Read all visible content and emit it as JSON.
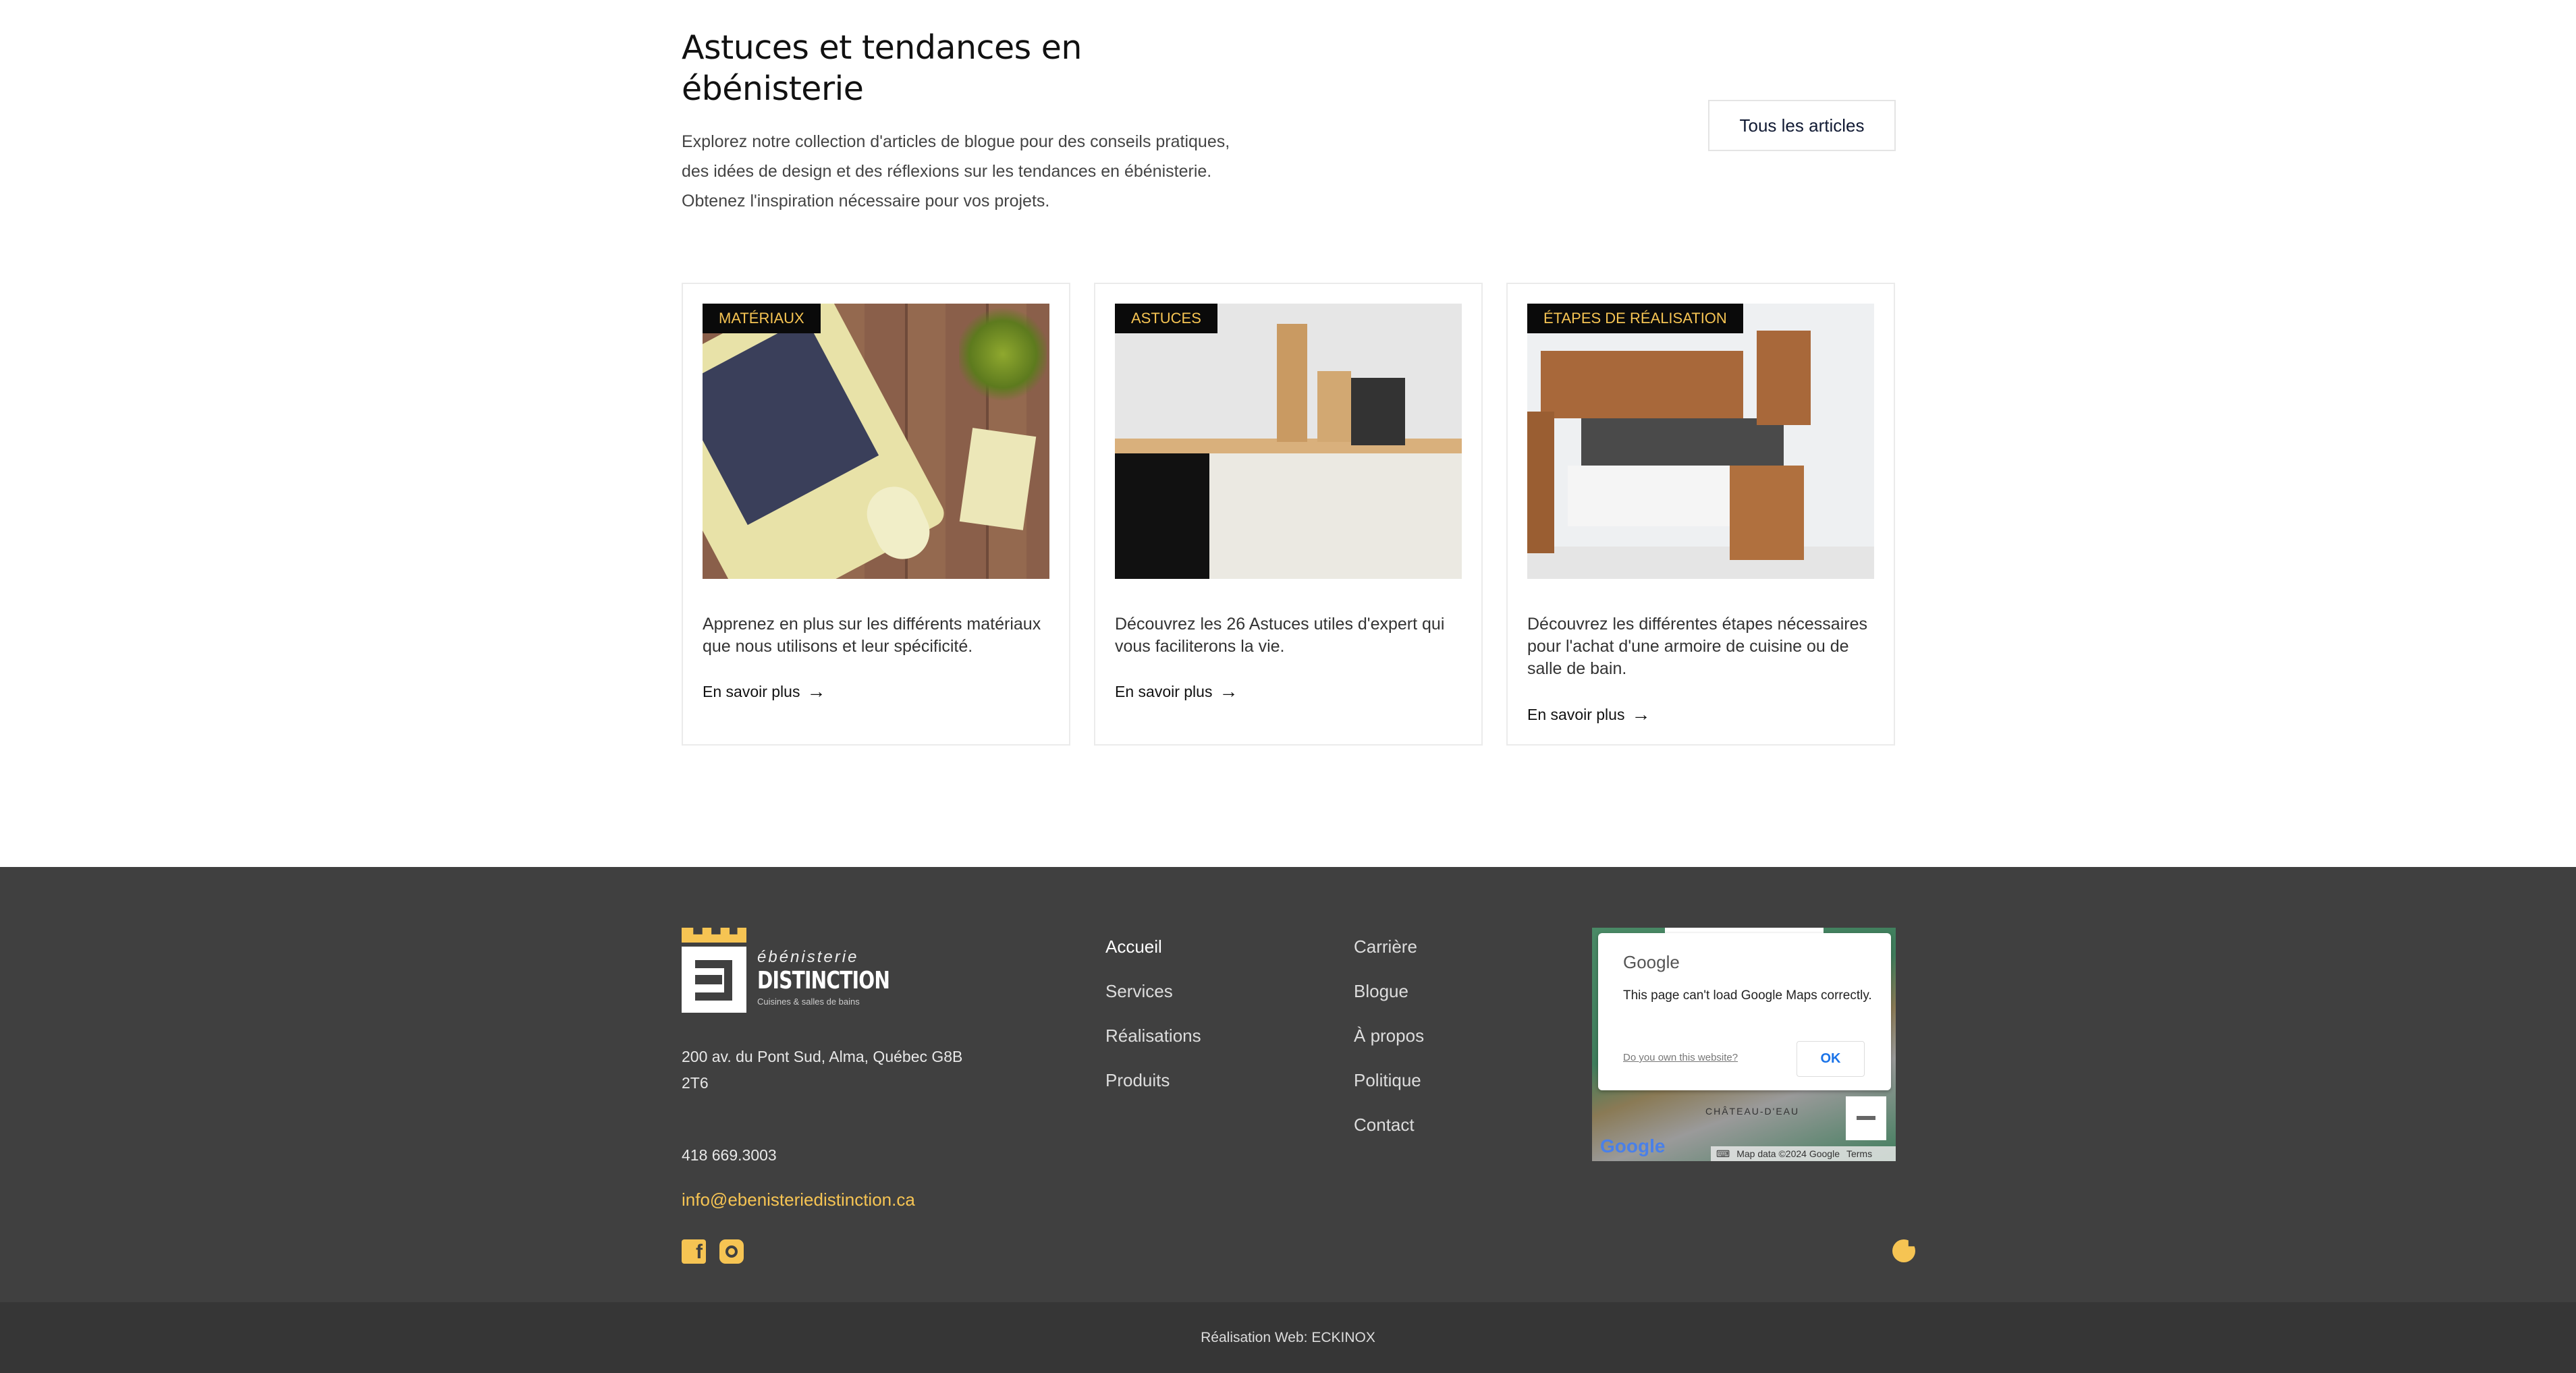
{
  "blog": {
    "title": "Astuces et tendances en ébénisterie",
    "intro": "Explorez notre collection d'articles de blogue pour des conseils pratiques, des idées de design et des réflexions sur les tendances en ébénisterie. Obtenez l'inspiration nécessaire pour vos projets.",
    "all_button": "Tous les articles",
    "cards": [
      {
        "tag": "Matériaux",
        "text": "Apprenez en plus sur les différents matériaux que nous utilisons et leur spécificité.",
        "link": "En savoir plus"
      },
      {
        "tag": "Astuces",
        "text": "Découvrez les 26 Astuces utiles d'expert qui vous faciliterons la vie.",
        "link": "En savoir plus"
      },
      {
        "tag": "Étapes de réalisation",
        "text": "Découvrez les différentes étapes nécessaires pour l'achat d'une armoire de cuisine ou de salle de bain.",
        "link": "En savoir plus"
      }
    ]
  },
  "footer": {
    "logo": {
      "line1": "ébénisterie",
      "line2": "DISTINCTION",
      "line3": "Cuisines & salles de bains"
    },
    "address_line1": "200 av. du Pont Sud, Alma, Québec G8B",
    "address_line2": "2T6",
    "phone": "418 669.3003",
    "email": "info@ebenisteriedistinction.ca",
    "nav_col1": [
      "Accueil",
      "Services",
      "Réalisations",
      "Produits"
    ],
    "nav_col2": [
      "Carrière",
      "Blogue",
      "À propos",
      "Politique",
      "Contact"
    ],
    "map": {
      "dialog_brand": "Google",
      "dialog_message": "This page can't load Google Maps correctly.",
      "dialog_link": "Do you own this website?",
      "dialog_ok": "OK",
      "place_label": "CHÂTEAU-D'EAU",
      "logo": "Google",
      "attribution": "Map data ©2024 Google",
      "terms": "Terms"
    },
    "icons": {
      "facebook": "facebook-icon",
      "instagram": "instagram-icon",
      "cookie": "cookie-icon"
    },
    "accent_color": "#f6c453",
    "credit": "Réalisation Web: ECKINOX"
  }
}
